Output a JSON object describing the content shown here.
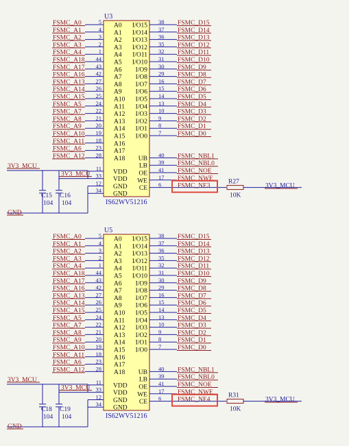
{
  "colors": {
    "background": "#f4f4ef",
    "wire": "#1b1b9c",
    "net_label": "#8c1a1a",
    "chip_fill": "#ffffa8",
    "chip_border": "#8c1a1a",
    "pin_text": "#111111",
    "pin_number": "#1b1b9c",
    "highlight": "#e0483c"
  },
  "chips": [
    {
      "ref": "U3",
      "part": "IS62WV51216",
      "left_pins": [
        {
          "net": "FSMC_A0",
          "num": "5",
          "pin": "A0"
        },
        {
          "net": "FSMC_A1",
          "num": "4",
          "pin": "A1"
        },
        {
          "net": "FSMC_A2",
          "num": "3",
          "pin": "A2"
        },
        {
          "net": "FSMC_A3",
          "num": "2",
          "pin": "A3"
        },
        {
          "net": "FSMC_A4",
          "num": "1",
          "pin": "A4"
        },
        {
          "net": "FSMC_A18",
          "num": "44",
          "pin": "A5"
        },
        {
          "net": "FSMC_A17",
          "num": "43",
          "pin": "A6"
        },
        {
          "net": "FSMC_A16",
          "num": "42",
          "pin": "A7"
        },
        {
          "net": "FSMC_A13",
          "num": "27",
          "pin": "A8"
        },
        {
          "net": "FSMC_A14",
          "num": "26",
          "pin": "A9"
        },
        {
          "net": "FSMC_A15",
          "num": "25",
          "pin": "A10"
        },
        {
          "net": "FSMC_A5",
          "num": "24",
          "pin": "A11"
        },
        {
          "net": "FSMC_A7",
          "num": "22",
          "pin": "A12"
        },
        {
          "net": "FSMC_A8",
          "num": "21",
          "pin": "A13"
        },
        {
          "net": "FSMC_A9",
          "num": "20",
          "pin": "A14"
        },
        {
          "net": "FSMC_A10",
          "num": "19",
          "pin": "A15"
        },
        {
          "net": "FSMC_A11",
          "num": "18",
          "pin": "A16"
        },
        {
          "net": "FSMC_A6",
          "num": "23",
          "pin": "A17"
        },
        {
          "net": "FSMC_A12",
          "num": "28",
          "pin": "A18"
        }
      ],
      "power_pins": [
        {
          "num": "11",
          "pin": "VDD",
          "net": "3V3_MCU"
        },
        {
          "num": "33",
          "pin": "VDD",
          "net": "3V3_MCU"
        },
        {
          "num": "12",
          "pin": "GND",
          "net": ""
        },
        {
          "num": "34",
          "pin": "GND",
          "net": ""
        }
      ],
      "right_pins": [
        {
          "pin": "I/O15",
          "num": "38",
          "net": "FSMC_D15"
        },
        {
          "pin": "I/O14",
          "num": "37",
          "net": "FSMC_D14"
        },
        {
          "pin": "I/O13",
          "num": "36",
          "net": "FSMC_D13"
        },
        {
          "pin": "I/O12",
          "num": "35",
          "net": "FSMC_D12"
        },
        {
          "pin": "I/O11",
          "num": "32",
          "net": "FSMC_D11"
        },
        {
          "pin": "I/O10",
          "num": "31",
          "net": "FSMC_D10"
        },
        {
          "pin": "I/O9",
          "num": "30",
          "net": "FSMC_D9"
        },
        {
          "pin": "I/O8",
          "num": "29",
          "net": "FSMC_D8"
        },
        {
          "pin": "I/O7",
          "num": "16",
          "net": "FSMC_D7"
        },
        {
          "pin": "I/O6",
          "num": "15",
          "net": "FSMC_D6"
        },
        {
          "pin": "I/O5",
          "num": "14",
          "net": "FSMC_D5"
        },
        {
          "pin": "I/O4",
          "num": "13",
          "net": "FSMC_D4"
        },
        {
          "pin": "I/O3",
          "num": "10",
          "net": "FSMC_D3"
        },
        {
          "pin": "I/O2",
          "num": "9",
          "net": "FSMC_D2"
        },
        {
          "pin": "I/O1",
          "num": "8",
          "net": "FSMC_D1"
        },
        {
          "pin": "I/O0",
          "num": "7",
          "net": "FSMC_D0"
        }
      ],
      "control_pins": [
        {
          "pin": "UB",
          "num": "40",
          "net": "FSMC_NBL1"
        },
        {
          "pin": "LB",
          "num": "39",
          "net": "FSMC_NBL0"
        },
        {
          "pin": "OE",
          "num": "41",
          "net": "FSMC_NOE"
        },
        {
          "pin": "WE",
          "num": "17",
          "net": "FSMC_NWE"
        },
        {
          "pin": "CE",
          "num": "6",
          "net": "FSMC_NE3"
        }
      ],
      "supply_label": "3V3_MCU",
      "gnd_label": "GND",
      "cap1": {
        "ref": "C15",
        "value": "104"
      },
      "cap2": {
        "ref": "C16",
        "value": "104"
      },
      "resistor": {
        "ref": "R27",
        "value": "10K"
      },
      "pullup_net": "3V3_MCU"
    },
    {
      "ref": "U5",
      "part": "IS62WV51216",
      "left_pins": [
        {
          "net": "FSMC_A0",
          "num": "5",
          "pin": "A0"
        },
        {
          "net": "FSMC_A1",
          "num": "4",
          "pin": "A1"
        },
        {
          "net": "FSMC_A2",
          "num": "3",
          "pin": "A2"
        },
        {
          "net": "FSMC_A3",
          "num": "2",
          "pin": "A3"
        },
        {
          "net": "FSMC_A4",
          "num": "1",
          "pin": "A4"
        },
        {
          "net": "FSMC_A18",
          "num": "44",
          "pin": "A5"
        },
        {
          "net": "FSMC_A17",
          "num": "43",
          "pin": "A6"
        },
        {
          "net": "FSMC_A16",
          "num": "42",
          "pin": "A7"
        },
        {
          "net": "FSMC_A13",
          "num": "27",
          "pin": "A8"
        },
        {
          "net": "FSMC_A14",
          "num": "26",
          "pin": "A9"
        },
        {
          "net": "FSMC_A15",
          "num": "25",
          "pin": "A10"
        },
        {
          "net": "FSMC_A5",
          "num": "24",
          "pin": "A11"
        },
        {
          "net": "FSMC_A7",
          "num": "22",
          "pin": "A12"
        },
        {
          "net": "FSMC_A8",
          "num": "21",
          "pin": "A13"
        },
        {
          "net": "FSMC_A9",
          "num": "20",
          "pin": "A14"
        },
        {
          "net": "FSMC_A10",
          "num": "19",
          "pin": "A15"
        },
        {
          "net": "FSMC_A11",
          "num": "18",
          "pin": "A16"
        },
        {
          "net": "FSMC_A6",
          "num": "23",
          "pin": "A17"
        },
        {
          "net": "FSMC_A12",
          "num": "28",
          "pin": "A18"
        }
      ],
      "power_pins": [
        {
          "num": "11",
          "pin": "VDD",
          "net": "3V3_MCU"
        },
        {
          "num": "33",
          "pin": "VDD",
          "net": "3V3_MCU"
        },
        {
          "num": "12",
          "pin": "GND",
          "net": ""
        },
        {
          "num": "34",
          "pin": "GND",
          "net": ""
        }
      ],
      "right_pins": [
        {
          "pin": "I/O15",
          "num": "38",
          "net": "FSMC_D15"
        },
        {
          "pin": "I/O14",
          "num": "37",
          "net": "FSMC_D14"
        },
        {
          "pin": "I/O13",
          "num": "36",
          "net": "FSMC_D13"
        },
        {
          "pin": "I/O12",
          "num": "35",
          "net": "FSMC_D12"
        },
        {
          "pin": "I/O11",
          "num": "32",
          "net": "FSMC_D11"
        },
        {
          "pin": "I/O10",
          "num": "31",
          "net": "FSMC_D10"
        },
        {
          "pin": "I/O9",
          "num": "30",
          "net": "FSMC_D9"
        },
        {
          "pin": "I/O8",
          "num": "29",
          "net": "FSMC_D8"
        },
        {
          "pin": "I/O7",
          "num": "16",
          "net": "FSMC_D7"
        },
        {
          "pin": "I/O6",
          "num": "15",
          "net": "FSMC_D6"
        },
        {
          "pin": "I/O5",
          "num": "14",
          "net": "FSMC_D5"
        },
        {
          "pin": "I/O4",
          "num": "13",
          "net": "FSMC_D4"
        },
        {
          "pin": "I/O3",
          "num": "10",
          "net": "FSMC_D3"
        },
        {
          "pin": "I/O2",
          "num": "9",
          "net": "FSMC_D2"
        },
        {
          "pin": "I/O1",
          "num": "8",
          "net": "FSMC_D1"
        },
        {
          "pin": "I/O0",
          "num": "7",
          "net": "FSMC_D0"
        }
      ],
      "control_pins": [
        {
          "pin": "UB",
          "num": "40",
          "net": "FSMC_NBL1"
        },
        {
          "pin": "LB",
          "num": "39",
          "net": "FSMC_NBL0"
        },
        {
          "pin": "OE",
          "num": "41",
          "net": "FSMC_NOE"
        },
        {
          "pin": "WE",
          "num": "17",
          "net": "FSMC_NWE"
        },
        {
          "pin": "CE",
          "num": "6",
          "net": "FSMC_NE4"
        }
      ],
      "supply_label": "3V3_MCU",
      "gnd_label": "GND",
      "cap1": {
        "ref": "C18",
        "value": "104"
      },
      "cap2": {
        "ref": "C19",
        "value": "104"
      },
      "resistor": {
        "ref": "R31",
        "value": "10K"
      },
      "pullup_net": "3V3_MCU"
    }
  ]
}
